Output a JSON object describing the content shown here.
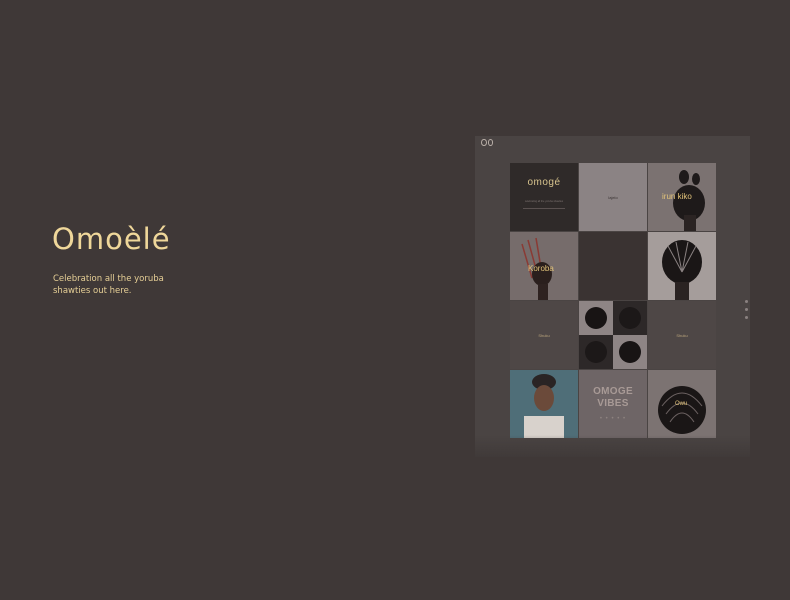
{
  "hero": {
    "title": "Omoèlé",
    "subtitle": "Celebration all the yoruba shawties out here."
  },
  "preview": {
    "logo_icon": "eyes-logo-icon",
    "tiles": [
      {
        "brand": "omogé",
        "tagline": "celebrating all the yoruba shawties"
      },
      {
        "label": "lajelo"
      },
      {
        "label": "irun kiko"
      },
      {
        "label": "Koroba"
      },
      {},
      {},
      {
        "label": "Shuku"
      },
      {},
      {
        "label": "Shuku"
      },
      {},
      {
        "line1": "OMOGE",
        "line2": "VIBES",
        "dots": "• • • • •"
      },
      {
        "label": "Owu"
      }
    ]
  },
  "pager": {
    "count": 3
  },
  "colors": {
    "background": "#3f3837",
    "accent": "#efd79a"
  }
}
